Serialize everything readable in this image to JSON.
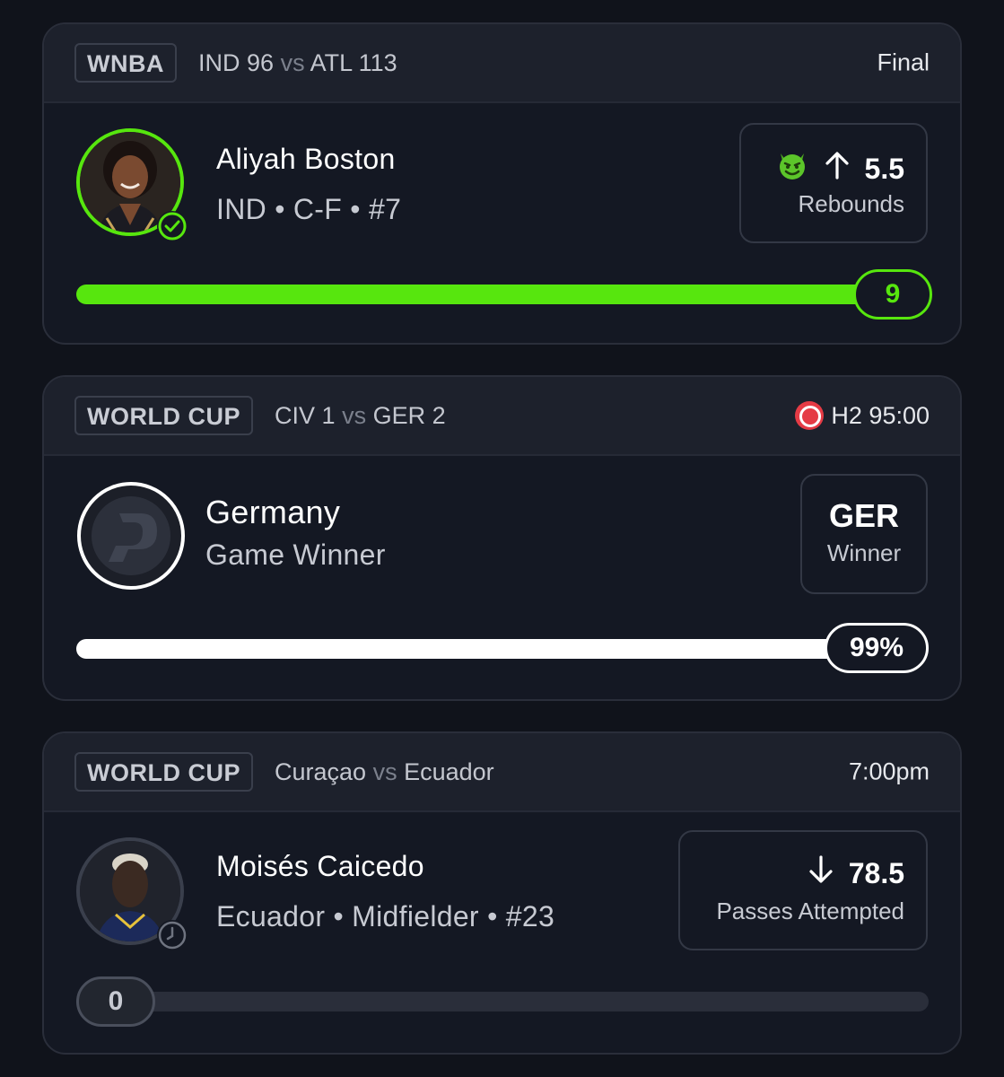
{
  "cards": [
    {
      "league": "WNBA",
      "matchup": {
        "team1": "IND",
        "score1": "96",
        "vs": "vs",
        "team2": "ATL",
        "score2": "113"
      },
      "status": "Final",
      "player": {
        "name": "Aliyah Boston",
        "details": "IND • C-F • #7"
      },
      "line": {
        "direction": "up",
        "value": "5.5",
        "stat": "Rebounds",
        "icon": "devil-emoji-icon"
      },
      "progress": {
        "value_label": "9",
        "fraction": 1.0,
        "color": "#57e60e"
      }
    },
    {
      "league": "WORLD CUP",
      "matchup": {
        "team1": "CIV",
        "score1": "1",
        "vs": "vs",
        "team2": "GER",
        "score2": "2"
      },
      "status": "H2 95:00",
      "player": {
        "name": "Germany",
        "details": "Game Winner"
      },
      "line": {
        "value": "GER",
        "stat": "Winner"
      },
      "progress": {
        "value_label": "99%",
        "fraction": 0.99,
        "color": "#ffffff"
      }
    },
    {
      "league": "WORLD CUP",
      "matchup": {
        "team1": "Curaçao",
        "vs": "vs",
        "team2": "Ecuador"
      },
      "status": "7:00pm",
      "player": {
        "name": "Moisés Caicedo",
        "details": "Ecuador • Midfielder • #23"
      },
      "line": {
        "direction": "down",
        "value": "78.5",
        "stat": "Passes Attempted"
      },
      "progress": {
        "value_label": "0",
        "fraction": 0.0,
        "color": "#2a2e3a"
      }
    }
  ],
  "colors": {
    "accent_green": "#57e60e",
    "live_red": "#e53b45",
    "background": "#10131b"
  }
}
